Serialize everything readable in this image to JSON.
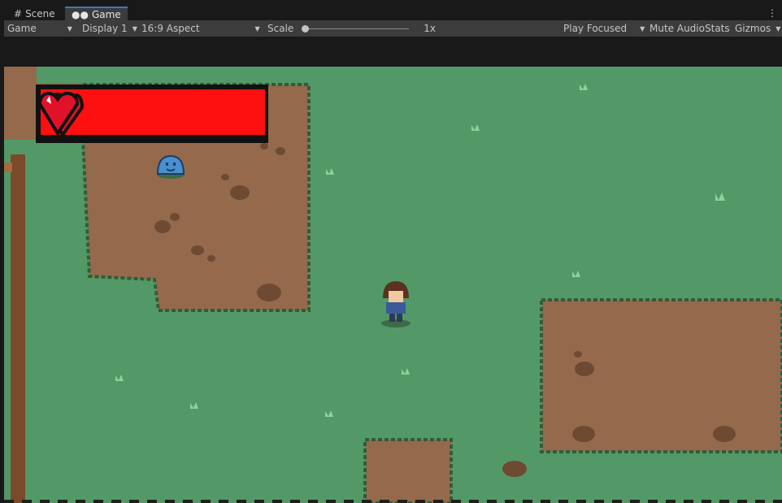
{
  "tabs": [
    {
      "label": "Scene",
      "icon": "hash-grid-icon"
    },
    {
      "label": "Game",
      "icon": "gamepad-icon"
    }
  ],
  "toolbar": {
    "game_select": "Game",
    "display": "Display 1",
    "aspect": "16:9 Aspect",
    "scale_label": "Scale",
    "scale_value": "1x",
    "play_mode": "Play Focused",
    "mute_audio": "Mute Audio",
    "stats": "Stats",
    "gizmos": "Gizmos"
  },
  "hud": {
    "health_fraction": 1.0,
    "heart_color": "#e0122a",
    "bar_color": "#ff1010"
  },
  "colors": {
    "grass": "#539967",
    "dirt": "#956a4c",
    "grass_edge": "#2d5e3a",
    "editor_bg": "#191919",
    "toolbar_bg": "#3c3c3c",
    "active_tab_accent": "#3a79bb"
  }
}
